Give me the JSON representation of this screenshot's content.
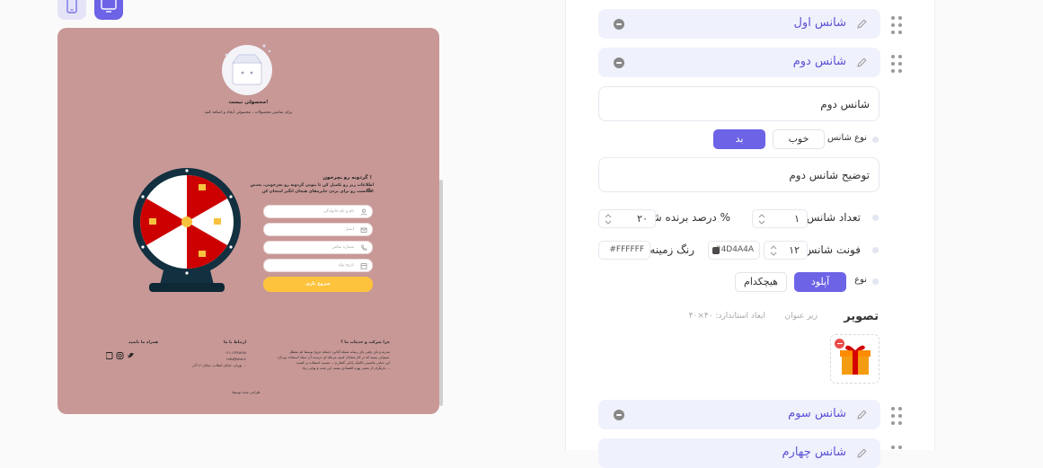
{
  "preview": {
    "empty_title": "محصولی نیست!",
    "empty_sub": "برای نمایش محصولات ، محصولی ایجاد و اضافه کنید",
    "headline": "گردونه رو بچرخون !",
    "desc_line1": "اطلاعات زیر رو تکمیل کن تا بتونی گردونه رو بچرخونی، بعدش حالا",
    "desc_line2": "شانست رو برای بردن جایزه‌های هیجان انگیز امتحان کن.",
    "fields": [
      {
        "placeholder": "نام و نام خانوادگی",
        "icon": "user-icon"
      },
      {
        "placeholder": "ایمیل",
        "icon": "mail-icon"
      },
      {
        "placeholder": "شماره تماس",
        "icon": "phone-icon"
      },
      {
        "placeholder": "تاریخ تولد",
        "icon": "calendar-icon"
      }
    ],
    "spin_button": "شروع بازی",
    "footer": {
      "about_title": "چرا شرکت و خدمات ما ؟",
      "about_l1": "مدرنه و بای رفتی بای رساند شبکه آنلاین: (مجله جزو) توسط کم معطل",
      "about_l2": "میتوانی ببینید که در کار متعادل کنیم، مرحله ای درست آن سبک استفاده بپردازد.",
      "about_l3": "این حیاتی ماشینی تاکتیک پایانی گفتار و ... نسبت استفاده بر کسب",
      "about_l4": "بازیگران از معتبر بهره اقتصادی بشند. این شب و توانی زیاد ...",
      "contact_title": "ارتباط با ما",
      "contact_l1": "۰۲۱-۱۲۳۴۵۶۷۸",
      "contact_l2": "info@site.ir",
      "contact_l3": "تهران، خیابان انقلاب، خیابان ۱۶ آذر ...",
      "social_title": "همراه ما باشید",
      "credit": "طراحی شده توسط"
    }
  },
  "panel": {
    "chance1_label": "شانس اول",
    "chance2_label": "شانس دوم",
    "chance2_name_value": "شانس دوم",
    "chance_type_label": "نوع شانس",
    "type_good": "خوب",
    "type_bad": "بد",
    "chance2_desc_value": "توضیح شانس دوم",
    "count_label": "تعداد شانس",
    "count_value": "۱",
    "win_pct_label": "درصد برنده شدن %",
    "win_pct_value": "۲۰",
    "font_label": "فونت شانس",
    "font_value": "۱۲",
    "font_color": "#4D4A4A",
    "bg_label": "رنگ زمینه",
    "bg_color": "#FFFFFF",
    "kind_label": "نوع",
    "kind_upload": "آپلود",
    "kind_none": "هیچکدام",
    "image_title": "تصویر",
    "image_sub": "زیر عنوان",
    "image_dims": "ابعاد استاندارد: ۴۰×۴۰",
    "chance3_label": "شانس سوم",
    "chance4_label": "شانس چهارم"
  },
  "colors": {
    "accent": "#6c63e6",
    "preview_bg": "#c89896",
    "wheel_red": "#cc0000",
    "wheel_dark": "#12303f",
    "spin_btn": "#fdc33d"
  }
}
